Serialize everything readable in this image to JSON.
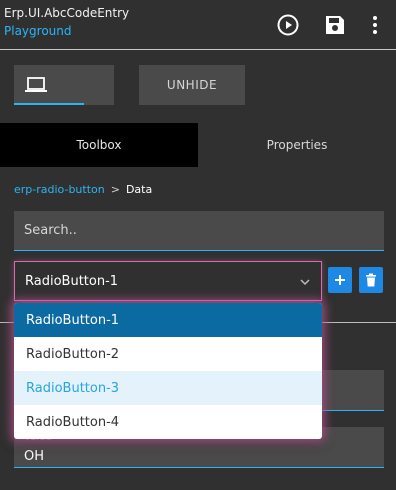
{
  "header": {
    "title": "Erp.UI.AbcCodeEntry",
    "subtitle": "Playground",
    "buttons": {
      "run_icon": "play-circle-icon",
      "save_icon": "save-icon",
      "more_icon": "more-vert-icon"
    }
  },
  "toolbar": {
    "device_icon": "laptop-icon",
    "unhide_label": "UNHIDE"
  },
  "tabs": [
    {
      "label": "Toolbox",
      "active": true
    },
    {
      "label": "Properties",
      "active": false
    }
  ],
  "breadcrumb": {
    "link": "erp-radio-button",
    "separator": ">",
    "current": "Data"
  },
  "search": {
    "placeholder": "Search..",
    "value": ""
  },
  "select": {
    "value": "RadioButton-1",
    "options": [
      "RadioButton-1",
      "RadioButton-2",
      "RadioButton-3",
      "RadioButton-4"
    ],
    "selected_index": 0,
    "hover_index": 2
  },
  "fields": {
    "value_label": "Value",
    "value": "OH"
  },
  "colors": {
    "accent": "#29b6f6",
    "selected_option": "#0b6aa2",
    "focus_glow": "#e06ab0",
    "action_button": "#1e88e5"
  }
}
